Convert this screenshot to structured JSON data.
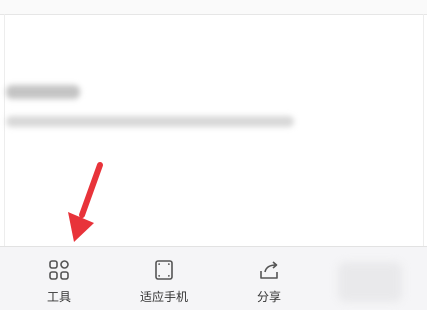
{
  "toolbar": {
    "items": [
      {
        "label": "工具",
        "icon": "grid-icon"
      },
      {
        "label": "适应手机",
        "icon": "fit-screen-icon"
      },
      {
        "label": "分享",
        "icon": "share-icon"
      }
    ]
  },
  "colors": {
    "toolbar_bg": "#f5f5f7",
    "icon": "#555555",
    "text": "#333333",
    "arrow": "#e8333a"
  }
}
